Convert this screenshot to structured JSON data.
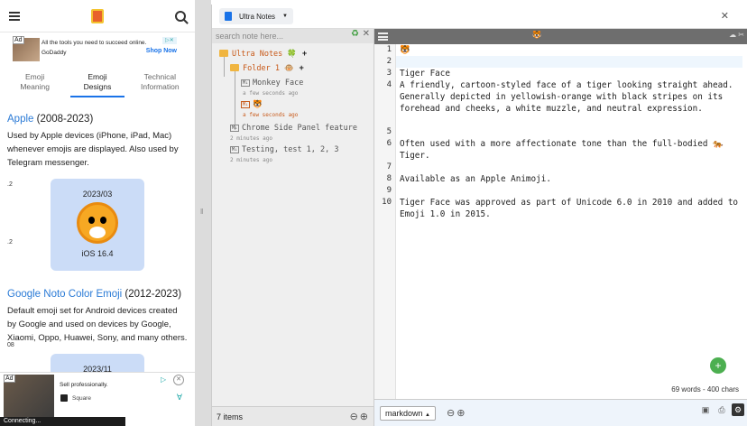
{
  "left": {
    "ad_top": {
      "label": "Ad",
      "line1": "All the tools you need to succeed online.",
      "line2": "GoDaddy",
      "cta": "Shop Now",
      "close": "▷✕"
    },
    "tabs": [
      {
        "line1": "Emoji",
        "line2": "Meaning"
      },
      {
        "line1": "Emoji",
        "line2": "Designs"
      },
      {
        "line1": "Technical",
        "line2": "Information"
      }
    ],
    "apple": {
      "vendor": "Apple",
      "years": " (2008-2023)",
      "desc": "Used by Apple devices (iPhone, iPad, Mac) whenever emojis are displayed. Also used by Telegram messenger.",
      "date": "2023/03",
      "os": "iOS 16.4"
    },
    "google": {
      "vendor": "Google Noto Color Emoji",
      "years": " (2012-2023)",
      "desc": "Default emoji set for Android devices created by Google and used on devices by Google, Xiaomi, Oppo, Huawei, Sony, and many others.",
      "date": "2023/11"
    },
    "edge_ticks": [
      ".2",
      ".2",
      "08"
    ],
    "ad_bottom": {
      "label": "Ad",
      "line1": "Sell professionally.",
      "brand": "Square"
    },
    "connecting": "Connecting..."
  },
  "app": {
    "tab_title": "Ultra Notes",
    "search_placeholder": "search note here...",
    "tree": {
      "root": "Ultra Notes 🍀",
      "folder": "Folder 1 🐵",
      "notes": [
        {
          "title": "Monkey Face",
          "ago": "a few seconds ago"
        },
        {
          "title": "🐯",
          "ago": "a few seconds ago"
        },
        {
          "title": "Chrome Side Panel feature",
          "ago": "2 minutes ago"
        },
        {
          "title": "Testing, test 1, 2, 3",
          "ago": "2 minutes ago"
        }
      ]
    },
    "items_count": "7 items",
    "editor": {
      "lines": [
        "🐯",
        "",
        "Tiger Face",
        "A friendly, cartoon-styled face of a tiger looking straight ahead. Generally depicted in yellowish-orange with black stripes on its forehead and cheeks, a white muzzle, and neutral expression.",
        "",
        "Often used with a more affectionate tone than the full-bodied 🐅 Tiger.",
        "",
        "Available as an Apple Animoji.",
        "",
        "Tiger Face was approved as part of Unicode 6.0 in 2010 and added to Emoji 1.0 in 2015."
      ],
      "status": "69 words - 400 chars",
      "mode": "markdown",
      "mode_caret": "▲"
    }
  }
}
